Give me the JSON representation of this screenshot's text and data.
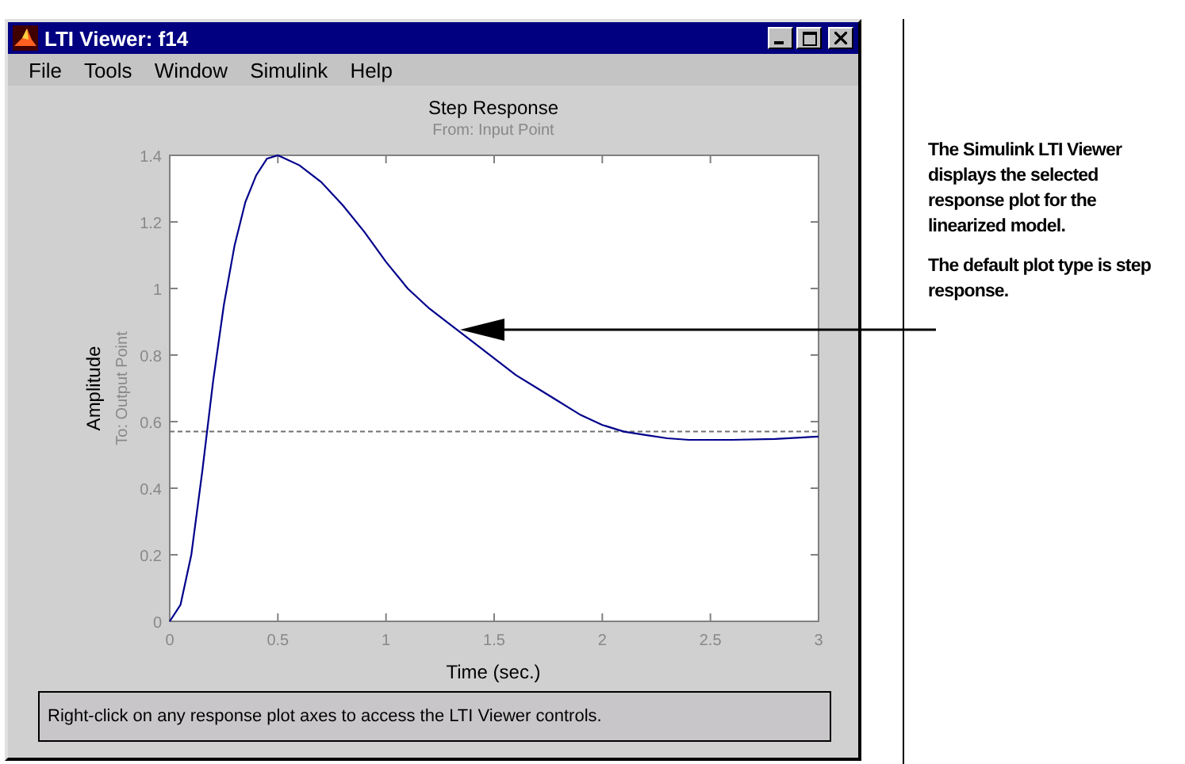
{
  "window": {
    "title": "LTI Viewer: f14"
  },
  "menu": [
    "File",
    "Tools",
    "Window",
    "Simulink",
    "Help"
  ],
  "plot": {
    "title": "Step Response",
    "input_label": "From: Input Point",
    "output_label": "To: Output Point",
    "chart_data": {
      "type": "line",
      "xlabel": "Time (sec.)",
      "ylabel": "Amplitude",
      "xlim": [
        0,
        3
      ],
      "ylim": [
        0,
        1.4
      ],
      "xticks": [
        0,
        0.5,
        1,
        1.5,
        2,
        2.5,
        3
      ],
      "yticks": [
        0,
        0.2,
        0.4,
        0.6,
        0.8,
        1,
        1.2,
        1.4
      ],
      "x": [
        0,
        0.05,
        0.1,
        0.15,
        0.2,
        0.25,
        0.3,
        0.35,
        0.4,
        0.45,
        0.5,
        0.6,
        0.7,
        0.8,
        0.9,
        1.0,
        1.1,
        1.2,
        1.3,
        1.4,
        1.5,
        1.6,
        1.7,
        1.8,
        1.9,
        2.0,
        2.1,
        2.2,
        2.3,
        2.4,
        2.6,
        2.8,
        3.0
      ],
      "series": [
        {
          "color": "#00008b",
          "values": [
            0,
            0.05,
            0.2,
            0.45,
            0.72,
            0.95,
            1.13,
            1.26,
            1.34,
            1.39,
            1.4,
            1.37,
            1.32,
            1.25,
            1.17,
            1.08,
            1.0,
            0.94,
            0.89,
            0.84,
            0.79,
            0.74,
            0.7,
            0.66,
            0.62,
            0.59,
            0.57,
            0.56,
            0.55,
            0.545,
            0.545,
            0.548,
            0.555
          ]
        }
      ],
      "ref_lines": [
        {
          "axis": "y",
          "value": 0.57
        }
      ]
    }
  },
  "status": "Right-click on any response plot axes to access the LTI Viewer controls.",
  "callout": [
    "The Simulink LTI Viewer displays the selected response plot for the linearized model.",
    "The default plot type is step response."
  ]
}
